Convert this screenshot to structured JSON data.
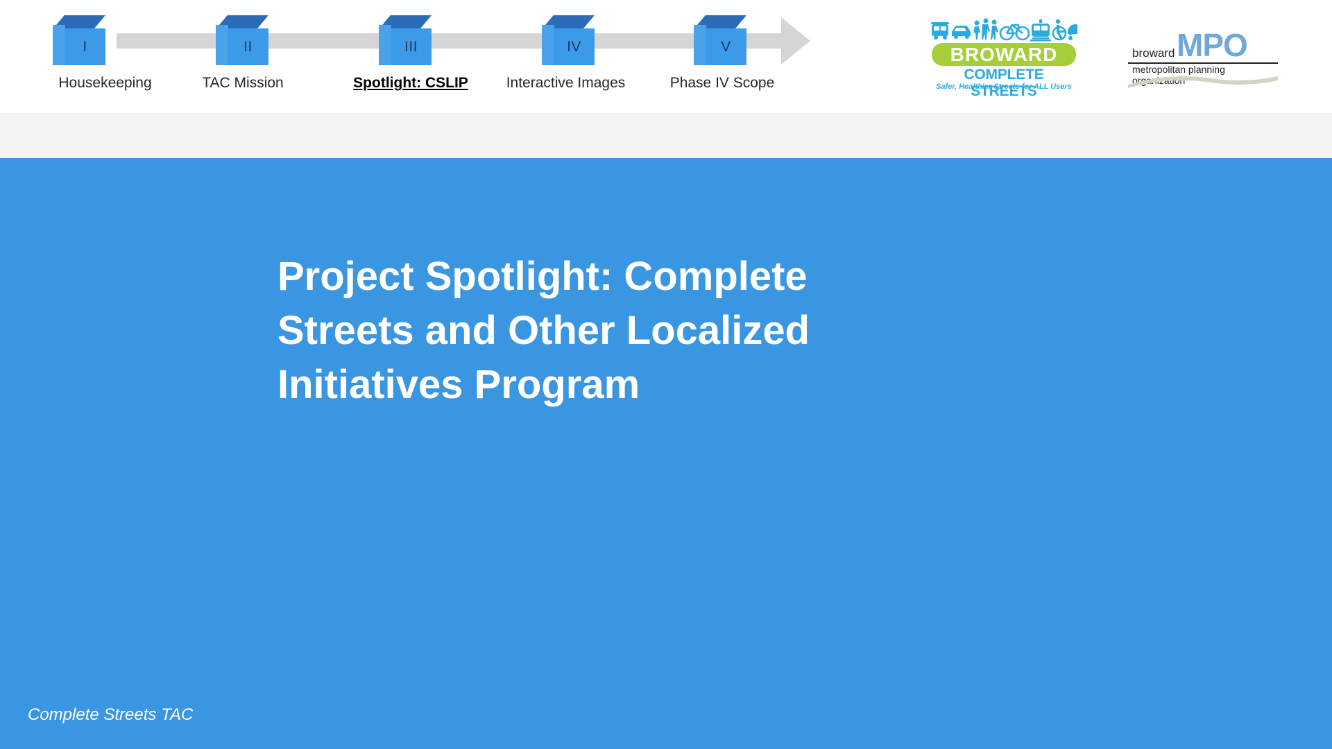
{
  "slide": {
    "title_lines": [
      "Project Spotlight: Complete",
      "Streets and Other Localized",
      "Initiatives Program"
    ],
    "title_full": "Project Spotlight: Complete Streets and Other Localized Initiatives Program",
    "footer": "Complete Streets TAC",
    "background_color": "#3a96e0",
    "title_color": "#ffffff"
  },
  "timeline": {
    "steps": [
      {
        "numeral": "I",
        "label": "Housekeeping",
        "active": false
      },
      {
        "numeral": "II",
        "label": "TAC Mission",
        "active": false
      },
      {
        "numeral": "III",
        "label": "Spotlight: CSLIP",
        "active": true
      },
      {
        "numeral": "IV",
        "label": "Interactive Images",
        "active": false
      },
      {
        "numeral": "V",
        "label": "Phase IV Scope",
        "active": false
      }
    ],
    "connector_color": "#d5d5d5",
    "cube_front_color": "#3d9ae8",
    "cube_top_color": "#2b6cb8",
    "cube_side_color": "#4aa3ea",
    "numeral_color": "#203864"
  },
  "logos": {
    "broward_complete_streets": {
      "name": "BROWARD",
      "subtitle": "COMPLETE STREETS",
      "tagline": "Safer, Healthier Streets for ALL Users",
      "bar_color": "#a6ce39",
      "text_color": "#29abe2",
      "icons": [
        "bus-icon",
        "car-icon",
        "pedestrian-icon",
        "bicycle-icon",
        "train-icon",
        "wheelchair-icon",
        "stroller-icon"
      ]
    },
    "broward_mpo": {
      "prefix": "broward",
      "acronym": "MPO",
      "subtitle": "metropolitan planning organization",
      "acronym_color": "#6fa8dc"
    }
  },
  "bands": {
    "header_color": "#ffffff",
    "gray_band_color": "#f3f3f3"
  }
}
